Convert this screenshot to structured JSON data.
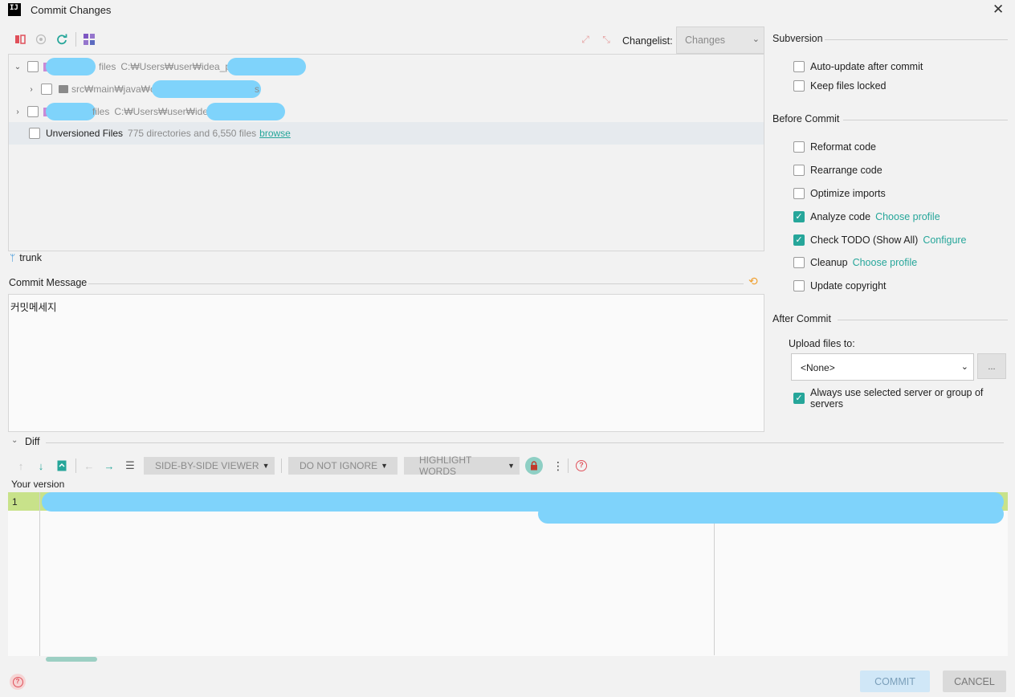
{
  "window": {
    "title": "Commit Changes",
    "app_icon_text": "IJ",
    "close_icon": "close-icon"
  },
  "toolbar": {
    "icons": [
      "rollback-icon",
      "show-diff-icon",
      "refresh-icon",
      "group-by-icon"
    ],
    "expand_icon": "expand-all-icon",
    "collapse_icon": "collapse-all-icon",
    "changelist_label": "Changelist:",
    "changelist_value": "Changes"
  },
  "tree": {
    "rows": [
      {
        "name_suffix": "files",
        "path": "C:₩Users₩user₩idea_p",
        "expanded": true
      },
      {
        "path": "src₩main₩java₩c",
        "trailing": "s",
        "expanded": false
      },
      {
        "name_suffix": "files",
        "path": "C:₩Users₩user₩ide",
        "expanded": false
      }
    ],
    "unversioned": {
      "label": "Unversioned Files",
      "summary": "775 directories and 6,550 files",
      "link": "browse"
    }
  },
  "branch": "trunk",
  "commit_message": {
    "label": "Commit Message",
    "value": "커밋메세지",
    "history_icon": "history-icon"
  },
  "subversion": {
    "label": "Subversion",
    "options": [
      {
        "label": "Auto-update after commit",
        "checked": false
      },
      {
        "label": "Keep files locked",
        "checked": false
      }
    ]
  },
  "before_commit": {
    "label": "Before Commit",
    "options": [
      {
        "label": "Reformat code",
        "checked": false,
        "link": ""
      },
      {
        "label": "Rearrange code",
        "checked": false,
        "link": ""
      },
      {
        "label": "Optimize imports",
        "checked": false,
        "link": ""
      },
      {
        "label": "Analyze code",
        "checked": true,
        "link": "Choose profile"
      },
      {
        "label": "Check TODO (Show All)",
        "checked": true,
        "link": "Configure"
      },
      {
        "label": "Cleanup",
        "checked": false,
        "link": "Choose profile"
      },
      {
        "label": "Update copyright",
        "checked": false,
        "link": ""
      }
    ]
  },
  "after_commit": {
    "label": "After Commit",
    "upload_label": "Upload files to:",
    "upload_value": "<None>",
    "ellipsis": "...",
    "always_use": {
      "label": "Always use selected server or group of servers",
      "checked": true
    }
  },
  "diff": {
    "label": "Diff",
    "viewer": "SIDE-BY-SIDE VIEWER",
    "ignore": "DO NOT IGNORE",
    "highlight": "HIGHLIGHT WORDS",
    "your_version": "Your version",
    "line_number": "1"
  },
  "footer": {
    "commit": "COMMIT",
    "cancel": "CANCEL",
    "help_icon": "help-icon"
  },
  "colors": {
    "accent": "#26a69a",
    "added_line": "#c8e28a",
    "redaction": "#7fd3fb"
  }
}
